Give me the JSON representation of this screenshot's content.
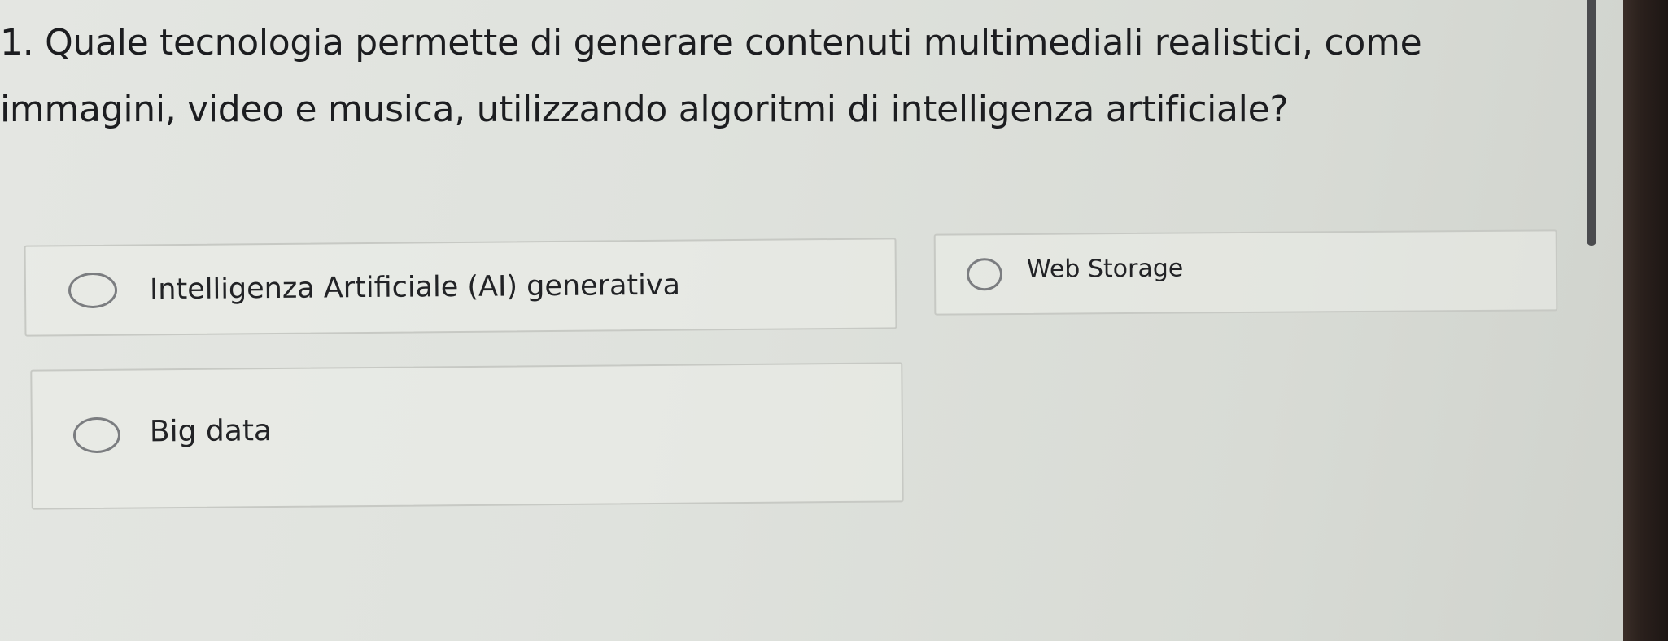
{
  "question": {
    "number": "1.",
    "text": "Quale tecnologia permette di generare contenuti multimediali realistici, come immagini, video e musica, utilizzando algoritmi di intelligenza artificiale?"
  },
  "options": [
    {
      "label": "Intelligenza Artificiale (AI) generativa",
      "selected": false
    },
    {
      "label": "Web Storage",
      "selected": false
    },
    {
      "label": "Big data",
      "selected": false
    }
  ],
  "colors": {
    "background": "#dfe2dd",
    "text": "#1c1d20",
    "radio_border": "#7b7d80",
    "option_border": "#c7c9c4",
    "bezel": "#2a201c"
  }
}
